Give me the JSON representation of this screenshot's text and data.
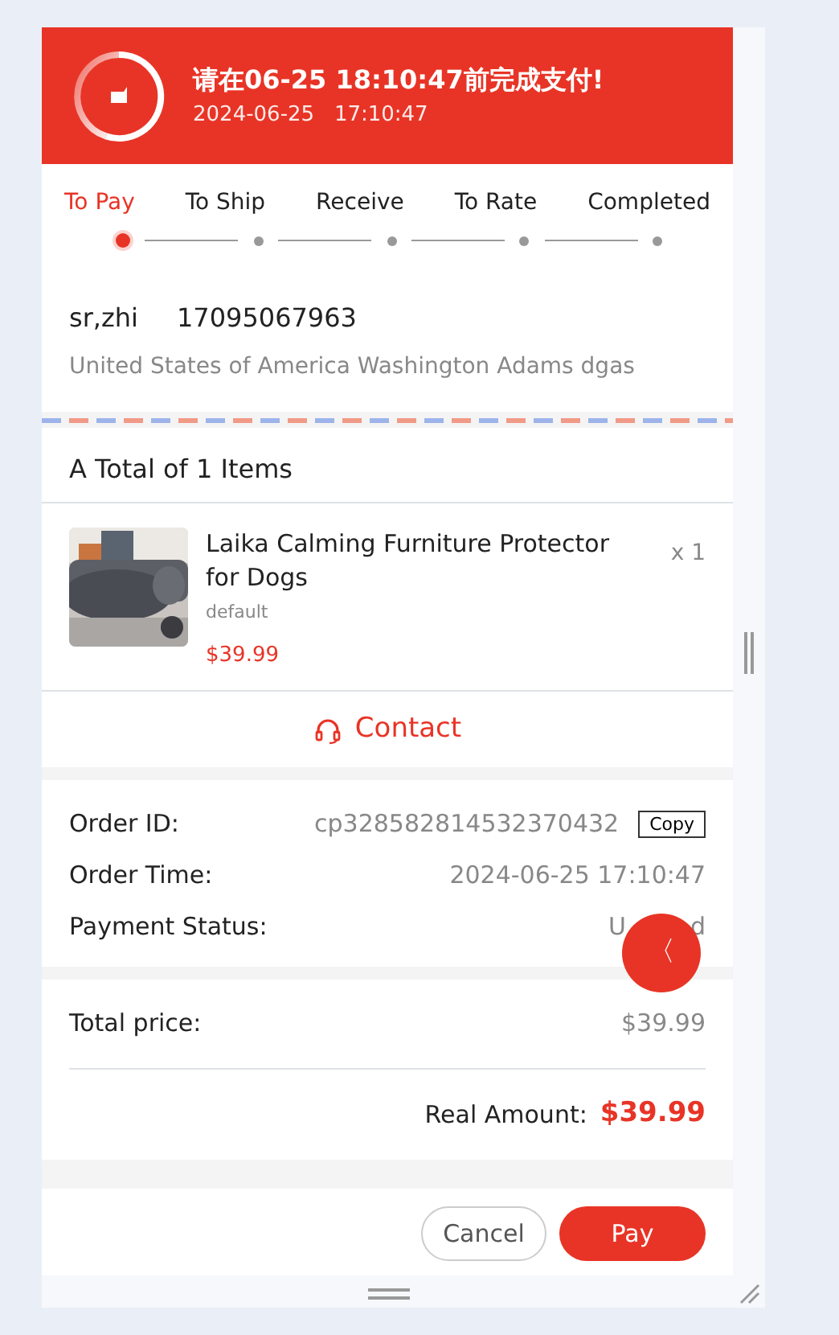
{
  "header": {
    "title": "请在06-25 18:10:47前完成支付!",
    "subtitle": "2024-06-25   17:10:47"
  },
  "steps": [
    {
      "label": "To Pay",
      "selected": true
    },
    {
      "label": "To Ship",
      "selected": false
    },
    {
      "label": "Receive",
      "selected": false
    },
    {
      "label": "To Rate",
      "selected": false
    },
    {
      "label": "Completed",
      "selected": false
    }
  ],
  "address": {
    "name": "sr,zhi",
    "phone": "17095067963",
    "line": "United States of America Washington Adams dgas"
  },
  "items_heading": "A Total of 1 Items",
  "products": [
    {
      "title": "Laika Calming Furniture Protector for Dogs",
      "variant": "default",
      "price": "$39.99",
      "quantity": "x 1",
      "kind": "picture"
    }
  ],
  "contact": "Contact",
  "order_info": [
    {
      "label": "Order ID:",
      "value": "cp328582814532370432",
      "action": "Copy"
    },
    {
      "label": "Order Time:",
      "value": "2024-06-25 17:10:47"
    },
    {
      "label": "Payment Status:",
      "value_parts": [
        "U",
        "d"
      ]
    }
  ],
  "totals": {
    "total_label": "Total price:",
    "total_value": "$39.99",
    "real_label": "Real Amount:",
    "real_value": "$39.99"
  },
  "floating_button": "〈",
  "buttons": [
    {
      "label": "Cancel",
      "kind": "outline"
    },
    {
      "label": "Pay",
      "kind": "primary"
    }
  ]
}
